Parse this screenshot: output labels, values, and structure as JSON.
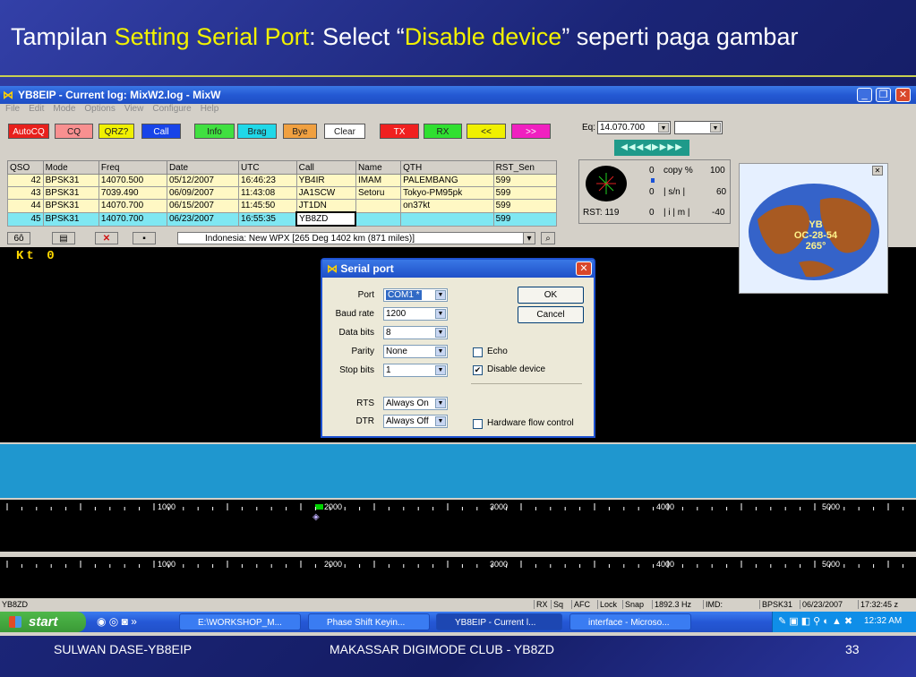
{
  "slide": {
    "title_parts": [
      "Tampilan ",
      "Setting Serial Port",
      ": Select “",
      "Disable device",
      "” seperti paga gambar"
    ],
    "footer_left": "SULWAN DASE-YB8EIP",
    "footer_center": "MAKASSAR DIGIMODE CLUB - YB8ZD",
    "footer_right": "33"
  },
  "app": {
    "title": "YB8EIP - Current log: MixW2.log - MixW",
    "menu": [
      "File",
      "Edit",
      "Mode",
      "Options",
      "View",
      "Configure",
      "Help"
    ],
    "macros": [
      {
        "label": "AutoCQ",
        "color": "#e8201c",
        "text": "#ffffff"
      },
      {
        "label": "CQ",
        "color": "#f89090",
        "text": "#202020"
      },
      {
        "label": "QRZ?",
        "color": "#f0f000",
        "text": "#202020"
      },
      {
        "label": "Call",
        "color": "#1844e8",
        "text": "#ffffff"
      },
      {
        "label": "Info",
        "color": "#40e040",
        "text": "#202020"
      },
      {
        "label": "Brag",
        "color": "#20d8e8",
        "text": "#202020"
      },
      {
        "label": "Bye",
        "color": "#f0a040",
        "text": "#202020"
      },
      {
        "label": "Clear",
        "color": "#ffffff",
        "text": "#202020"
      },
      {
        "label": "TX",
        "color": "#f02020",
        "text": "#ffffff"
      },
      {
        "label": "RX",
        "color": "#30e030",
        "text": "#202020"
      },
      {
        "label": "<<",
        "color": "#f0f000",
        "text": "#202020"
      },
      {
        "label": ">>",
        "color": "#f020c0",
        "text": "#ffffff"
      }
    ],
    "log": {
      "headers": [
        "QSO",
        "Mode",
        "Freq",
        "Date",
        "UTC",
        "Call",
        "Name",
        "QTH",
        "RST_Sen"
      ],
      "rows": [
        [
          "42",
          "BPSK31",
          "14070.500",
          "05/12/2007",
          "16:46:23",
          "YB4IR",
          "IMAM",
          "PALEMBANG",
          "599"
        ],
        [
          "43",
          "BPSK31",
          "7039.490",
          "06/09/2007",
          "11:43:08",
          "JA1SCW",
          "Setoru",
          "Tokyo-PM95pk",
          "599"
        ],
        [
          "44",
          "BPSK31",
          "14070.700",
          "06/15/2007",
          "11:45:50",
          "JT1DN",
          "",
          "on37kt",
          "599"
        ],
        [
          "45",
          "BPSK31",
          "14070.700",
          "06/23/2007",
          "16:55:35",
          "YB8ZD",
          "",
          "",
          "599"
        ]
      ]
    },
    "qth_info": "Indonesia:  New WPX [265 Deg  1402 km (871 miles)]",
    "eq_label": "Eq:",
    "frequency": "14.070.700",
    "tune_arrows": "◀◀◀◀▶▶▶▶",
    "rst_label": "RST: 119",
    "meter": {
      "copy_left": "0",
      "copy_label": "copy %",
      "copy_right": "100",
      "sn_left": "0",
      "sn_label": "| s/n |",
      "sn_right": "60",
      "imd_left": "0",
      "imd_label": "| i  | m  |",
      "imd_right": "-40"
    },
    "rx_text": "Kt 0",
    "waterfall_ticks": [
      "1000",
      "2000",
      "3000",
      "4000",
      "5000"
    ],
    "status": {
      "call": "YB8ZD",
      "cells": [
        "RX",
        "Sq",
        "AFC",
        "Lock",
        "Snap",
        "1892.3 Hz",
        "IMD:",
        "BPSK31",
        "06/23/2007",
        "17:32:45 z"
      ]
    },
    "map": {
      "label_1": "YB",
      "label_2": "OC-28-54",
      "label_3": "265°"
    }
  },
  "dialog": {
    "title": "Serial port",
    "fields": [
      {
        "label": "Port",
        "value": "COM1 *"
      },
      {
        "label": "Baud rate",
        "value": "1200"
      },
      {
        "label": "Data bits",
        "value": "8"
      },
      {
        "label": "Parity",
        "value": "None"
      },
      {
        "label": "Stop bits",
        "value": "1"
      }
    ],
    "rts": {
      "label": "RTS",
      "value": "Always On"
    },
    "dtr": {
      "label": "DTR",
      "value": "Always Off"
    },
    "ok": "OK",
    "cancel": "Cancel",
    "echo": {
      "label": "Echo",
      "checked": false
    },
    "disable_device": {
      "label": "Disable device",
      "checked": true
    },
    "hw_flow": {
      "label": "Hardware flow control",
      "checked": false
    }
  },
  "taskbar": {
    "start": "start",
    "tasks": [
      {
        "label": "E:\\WORKSHOP_M...",
        "active": false
      },
      {
        "label": "Phase Shift Keyin...",
        "active": false
      },
      {
        "label": "YB8EIP - Current l...",
        "active": true
      },
      {
        "label": "interface - Microso...",
        "active": false
      }
    ],
    "clock": "12:32 AM"
  }
}
